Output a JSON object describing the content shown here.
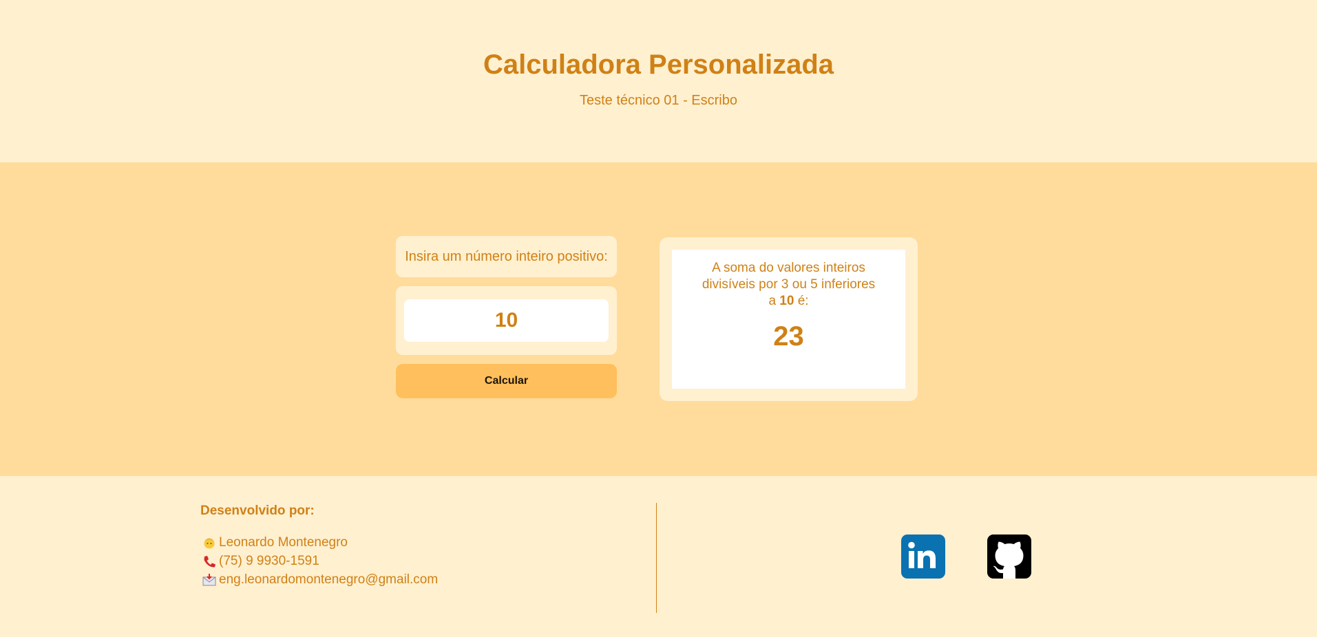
{
  "header": {
    "title": "Calculadora Personalizada",
    "subtitle": "Teste técnico 01 - Escribo"
  },
  "calculator": {
    "prompt": "Insira um número inteiro positivo:",
    "input_value": "10",
    "button_label": "Calcular"
  },
  "result": {
    "text_before": "A soma do valores inteiros divisíveis por 3 ou 5 inferiores a ",
    "limit": "10",
    "text_after": " é:",
    "value": "23"
  },
  "footer": {
    "heading": "Desenvolvido por:",
    "name": "Leonardo Montenegro",
    "phone": "(75) 9 9930-1591",
    "email": "eng.leonardomontenegro@gmail.com",
    "social": [
      {
        "name": "linkedin",
        "icon": "linkedin-icon",
        "color": "#0a72b1"
      },
      {
        "name": "github",
        "icon": "github-icon",
        "color": "#000000"
      }
    ]
  },
  "colors": {
    "accent": "#cf8116",
    "light_bg": "#fff0d0",
    "main_bg": "#ffdc9c",
    "button": "#ffbf5c"
  }
}
